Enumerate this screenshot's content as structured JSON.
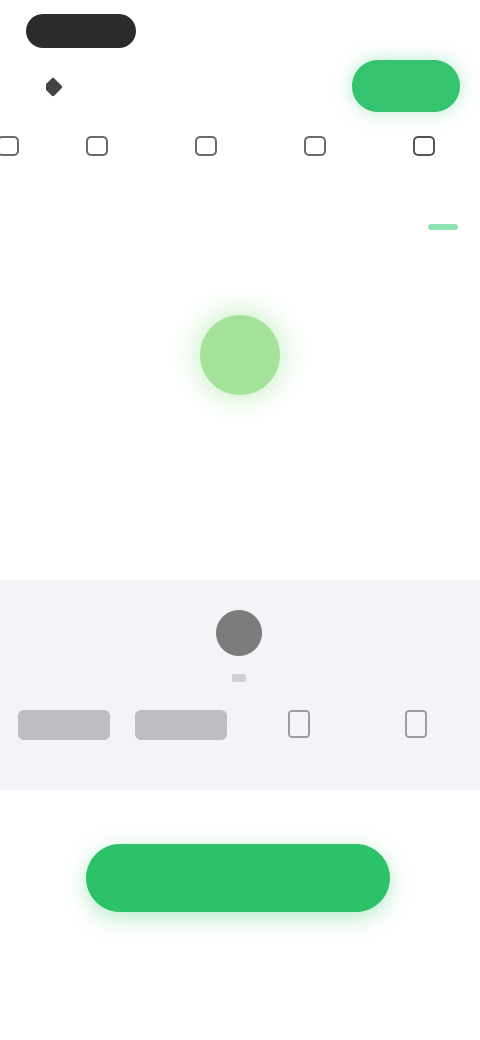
{
  "status": {
    "right_label": ""
  },
  "header": {
    "title": "",
    "action_label": ""
  },
  "tools": [
    {
      "label": "",
      "icon": "document-icon"
    },
    {
      "label": "",
      "icon": "crop-icon"
    },
    {
      "label": "",
      "icon": "adjust-icon"
    },
    {
      "label": "",
      "icon": "filter-icon"
    },
    {
      "label": "",
      "icon": "more-icon"
    }
  ],
  "center": {
    "link_label": ""
  },
  "panel": {
    "options": [
      {
        "label": "",
        "kind": "box"
      },
      {
        "label": "",
        "kind": "box"
      },
      {
        "label": "",
        "kind": "glyph"
      },
      {
        "label": "",
        "kind": "glyph"
      }
    ]
  },
  "cta": {
    "label": ""
  },
  "footer": {
    "link_label": ""
  },
  "colors": {
    "accent": "#2ec268",
    "accent_light": "#a6e39a",
    "panel_bg": "#f4f3f7",
    "link": "#55c68a"
  }
}
